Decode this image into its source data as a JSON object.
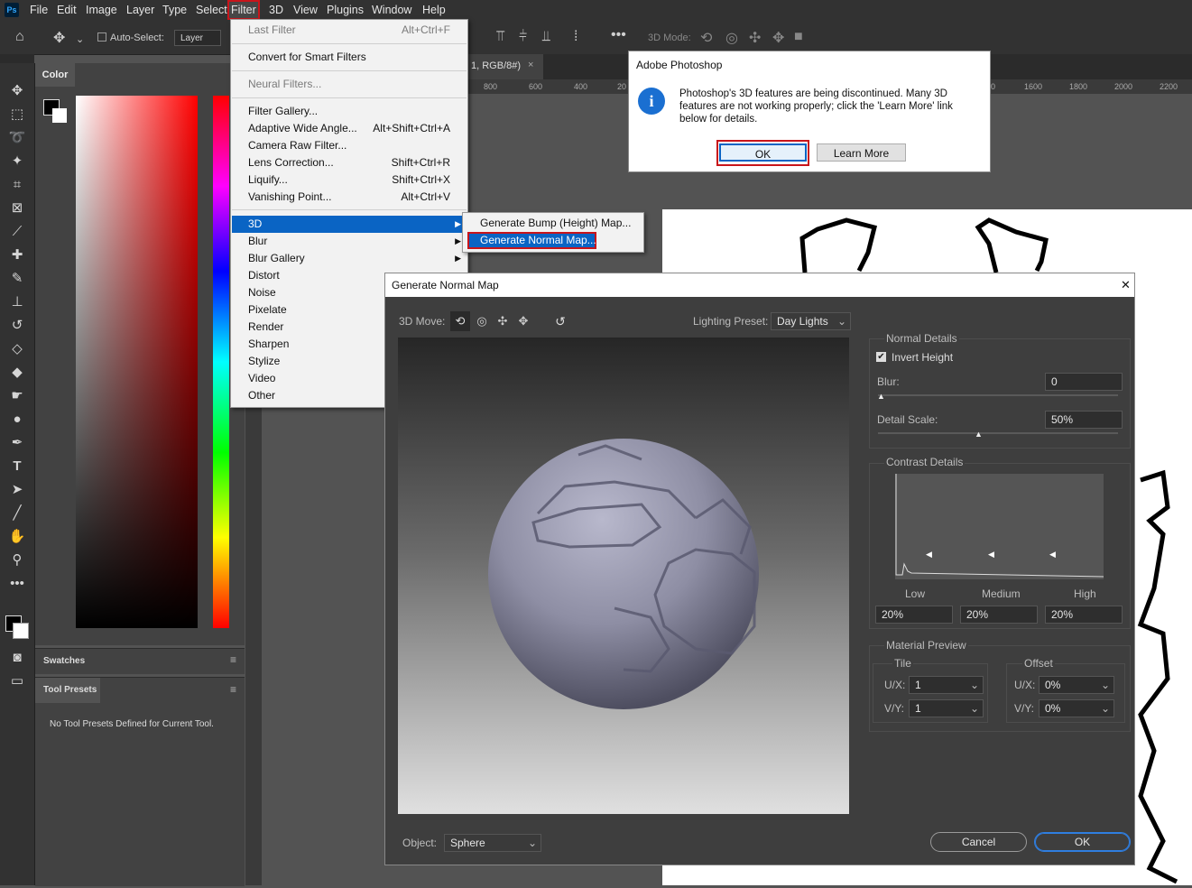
{
  "app": {
    "logo": "Ps"
  },
  "menubar": {
    "items": [
      "File",
      "Edit",
      "Image",
      "Layer",
      "Type",
      "Select",
      "Filter",
      "3D",
      "View",
      "Plugins",
      "Window",
      "Help"
    ]
  },
  "options_bar": {
    "auto_select": "Auto-Select:",
    "layer_select": "Layer",
    "mode_3d": "3D Mode:"
  },
  "color_panel": {
    "title": "Color"
  },
  "swatches_panel": {
    "title": "Swatches"
  },
  "tool_presets": {
    "title": "Tool Presets",
    "empty": "No Tool Presets Defined for Current Tool."
  },
  "document": {
    "tab_title": "1, RGB/8#)",
    "tab_close": "×",
    "ruler_ticks": [
      "800",
      "600",
      "400",
      "20",
      "0",
      "1600",
      "1800",
      "2000",
      "2200"
    ]
  },
  "filter_menu": {
    "items": [
      {
        "label": "Last Filter",
        "shortcut": "Alt+Ctrl+F",
        "disabled": true
      },
      {
        "label": "Convert for Smart Filters"
      },
      {
        "label": "Neural Filters...",
        "disabled": true
      },
      {
        "label": "Filter Gallery..."
      },
      {
        "label": "Adaptive Wide Angle...",
        "shortcut": "Alt+Shift+Ctrl+A"
      },
      {
        "label": "Camera Raw Filter..."
      },
      {
        "label": "Lens Correction...",
        "shortcut": "Shift+Ctrl+R"
      },
      {
        "label": "Liquify...",
        "shortcut": "Shift+Ctrl+X"
      },
      {
        "label": "Vanishing Point...",
        "shortcut": "Alt+Ctrl+V"
      },
      {
        "label": "3D",
        "submenu": true,
        "highlighted": true
      },
      {
        "label": "Blur",
        "submenu": true
      },
      {
        "label": "Blur Gallery",
        "submenu": true
      },
      {
        "label": "Distort",
        "submenu": true
      },
      {
        "label": "Noise"
      },
      {
        "label": "Pixelate"
      },
      {
        "label": "Render"
      },
      {
        "label": "Sharpen"
      },
      {
        "label": "Stylize"
      },
      {
        "label": "Video"
      },
      {
        "label": "Other"
      }
    ],
    "submenu_3d": [
      "Generate Bump (Height) Map...",
      "Generate Normal Map..."
    ]
  },
  "alert": {
    "title": "Adobe Photoshop",
    "icon": "info-icon",
    "message": "Photoshop's 3D features are being discontinued. Many 3D features are not working properly; click the 'Learn More' link below for details.",
    "ok": "OK",
    "learn_more": "Learn More"
  },
  "dialog": {
    "title": "Generate Normal Map",
    "close": "✕",
    "move_label": "3D Move:",
    "lighting_label": "Lighting Preset:",
    "lighting_value": "Day Lights",
    "normal_details": {
      "title": "Normal Details",
      "invert_height": "Invert Height",
      "invert_checked": true,
      "blur_label": "Blur:",
      "blur_value": "0",
      "blur_slider": 0,
      "detail_label": "Detail Scale:",
      "detail_value": "50%",
      "detail_slider": 0.5
    },
    "contrast": {
      "title": "Contrast Details",
      "low": "Low",
      "medium": "Medium",
      "high": "High",
      "low_value": "20%",
      "medium_value": "20%",
      "high_value": "20%"
    },
    "material": {
      "title": "Material Preview",
      "tile": "Tile",
      "offset": "Offset",
      "ux": "U/X:",
      "vy": "V/Y:",
      "tile_ux": "1",
      "tile_vy": "1",
      "offset_ux": "0%",
      "offset_vy": "0%"
    },
    "object_label": "Object:",
    "object_value": "Sphere",
    "cancel": "Cancel",
    "ok": "OK"
  },
  "colors": {
    "accent": "#0a64c4",
    "highlight_red": "#c8151b",
    "bg_dark": "#323232"
  }
}
